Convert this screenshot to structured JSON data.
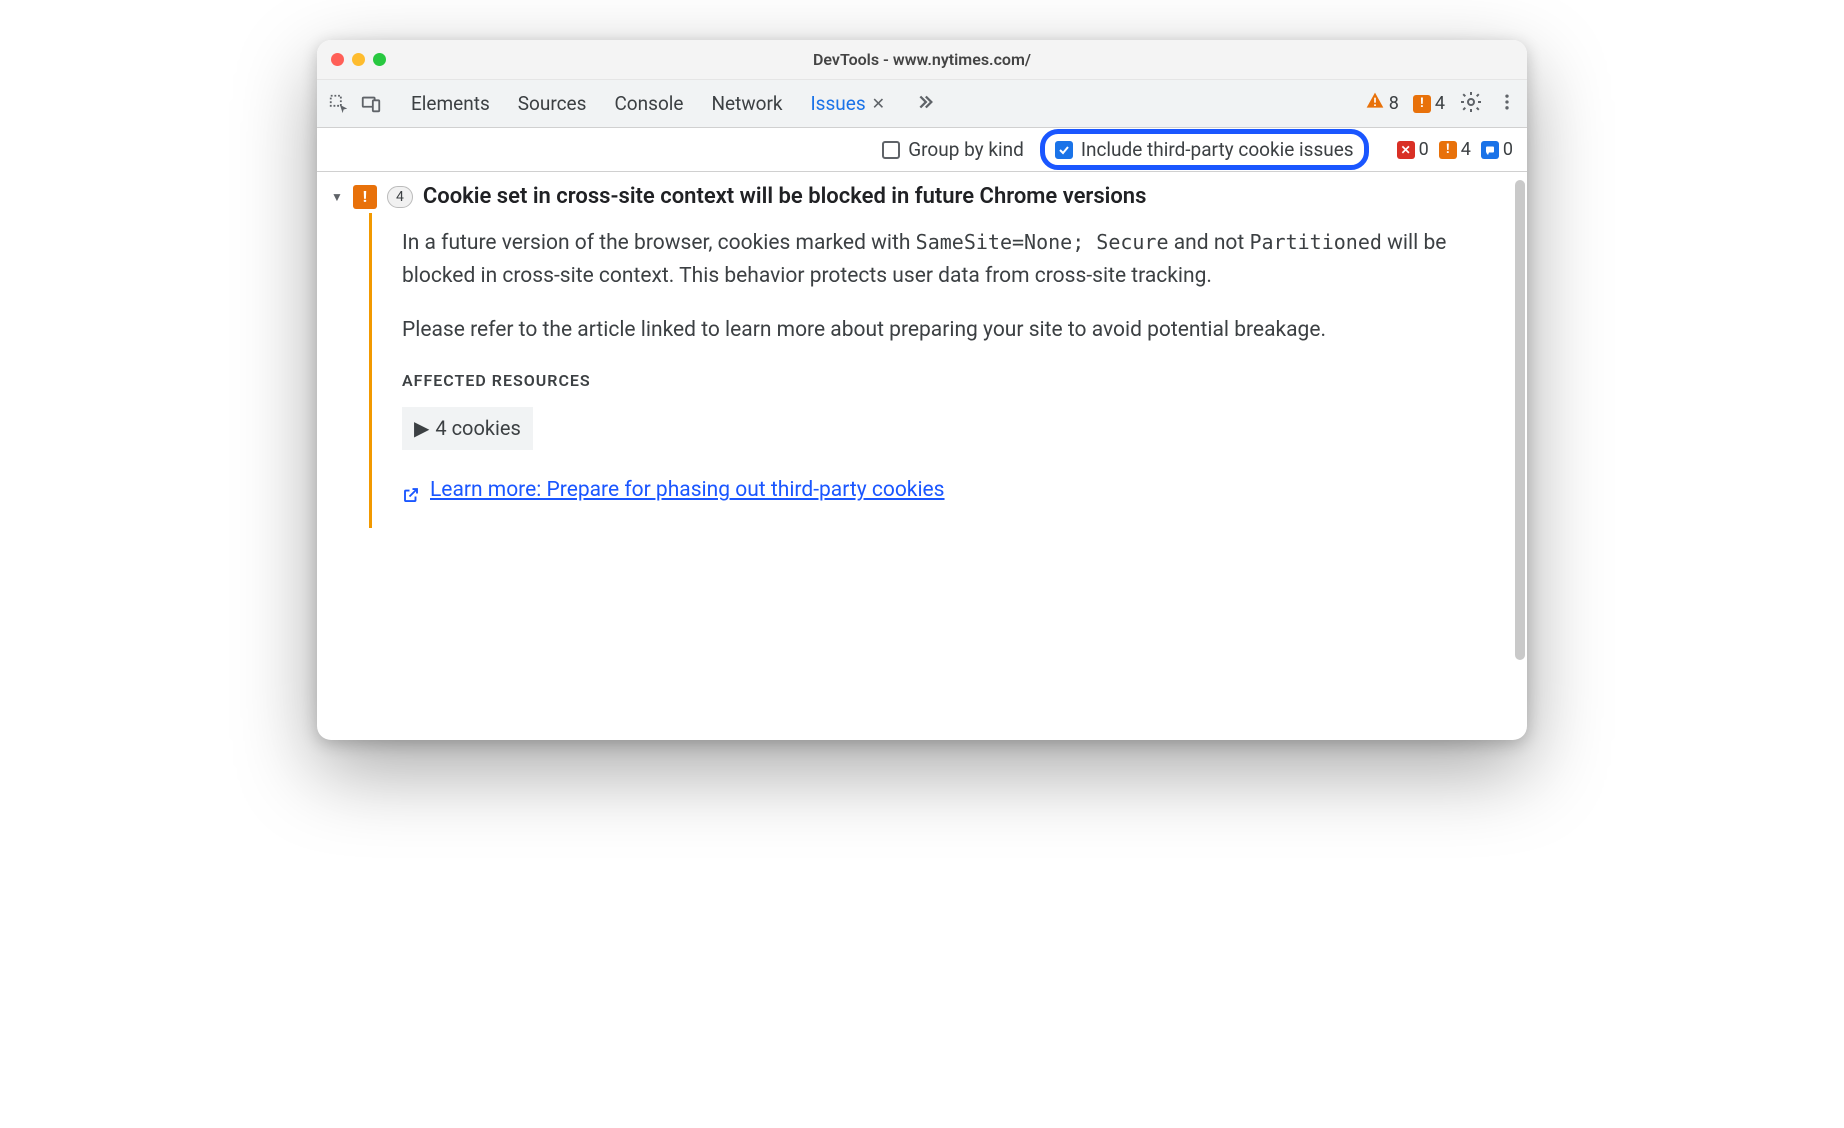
{
  "window": {
    "title": "DevTools - www.nytimes.com/"
  },
  "tabs": {
    "items": [
      "Elements",
      "Sources",
      "Console",
      "Network",
      "Issues"
    ],
    "active": "Issues"
  },
  "top_status": {
    "warning_count": "8",
    "breaking_count": "4"
  },
  "filters": {
    "group_by_kind": {
      "label": "Group by kind",
      "checked": false
    },
    "include_third_party": {
      "label": "Include third-party cookie issues",
      "checked": true
    }
  },
  "issue_counts": {
    "errors": "0",
    "breaking": "4",
    "info": "0"
  },
  "issue": {
    "count": "4",
    "title": "Cookie set in cross-site context will be blocked in future Chrome versions",
    "body_pre": "In a future version of the browser, cookies marked with ",
    "code1": "SameSite=None; Secure",
    "body_mid1": " and not ",
    "code2": "Partitioned",
    "body_post1": " will be blocked in cross-site context. This behavior protects user data from cross-site tracking.",
    "body2": "Please refer to the article linked to learn more about preparing your site to avoid potential breakage.",
    "affected_heading": "AFFECTED RESOURCES",
    "affected_item": "4 cookies",
    "learn_more": "Learn more: Prepare for phasing out third-party cookies"
  }
}
